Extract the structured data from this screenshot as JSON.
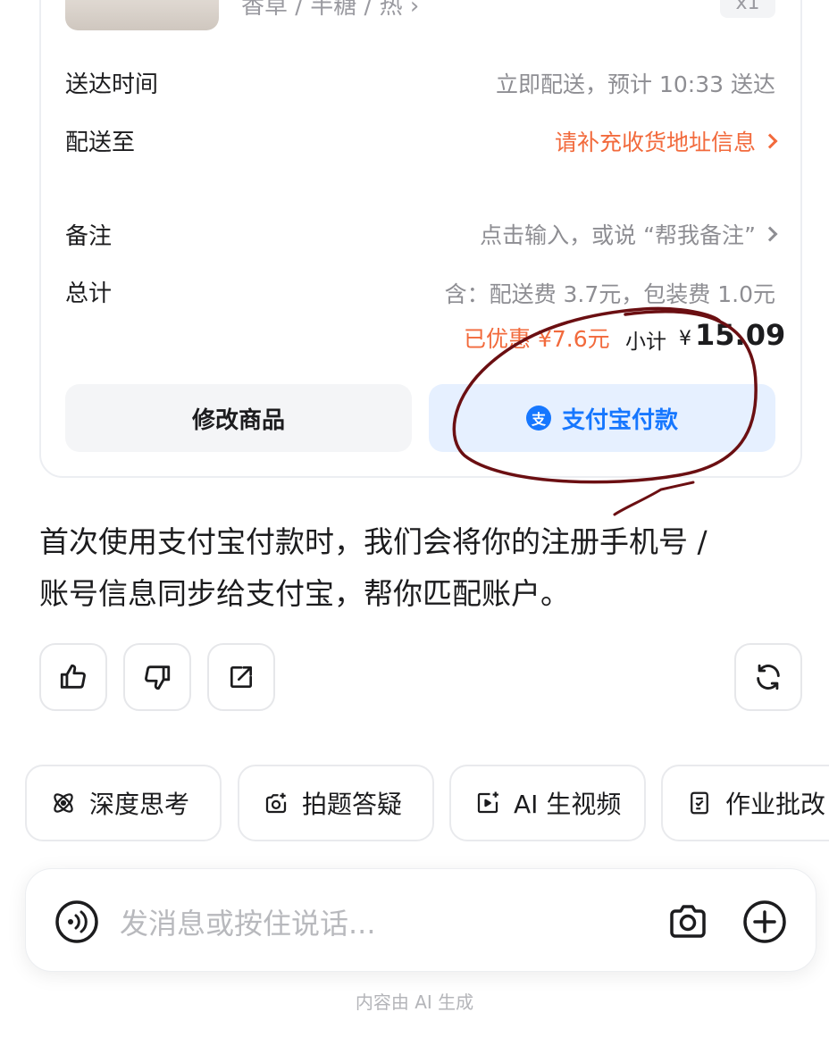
{
  "order": {
    "spec_partial": "香草 / 半糖 / 热 ›",
    "qty_partial": "x1",
    "rows": [
      {
        "label": "送达时间",
        "value": "立即配送，预计 10:33 送达"
      },
      {
        "label": "配送至",
        "value": "请补充收货地址信息"
      },
      {
        "label": "备注",
        "value": "点击输入，或说 “帮我备注”"
      },
      {
        "label": "总计",
        "value": "含：配送费 3.7元，包装费 1.0元"
      }
    ],
    "discount": "已优惠 ¥7.6元",
    "subtotal_label": "小计",
    "currency": "¥",
    "subtotal_amount": "15.09",
    "edit_button": "修改商品",
    "pay_button": "支付宝付款",
    "pay_badge": "支"
  },
  "message": {
    "line1": "首次使用支付宝付款时，我们会将你的注册手机号 /",
    "line2": "账号信息同步给支付宝，帮你匹配账户。"
  },
  "chips": [
    {
      "label": "深度思考",
      "icon": "atom-icon"
    },
    {
      "label": "拍题答疑",
      "icon": "camera-scan-icon"
    },
    {
      "label": "AI 生视频",
      "icon": "video-icon"
    },
    {
      "label": "作业批改",
      "icon": "homework-icon"
    }
  ],
  "input": {
    "placeholder": "发消息或按住说话..."
  },
  "footer": "内容由 AI 生成",
  "colors": {
    "accent_orange": "#f26a3c",
    "alipay_blue": "#1677ff",
    "annotation_red": "#6b0f12"
  }
}
